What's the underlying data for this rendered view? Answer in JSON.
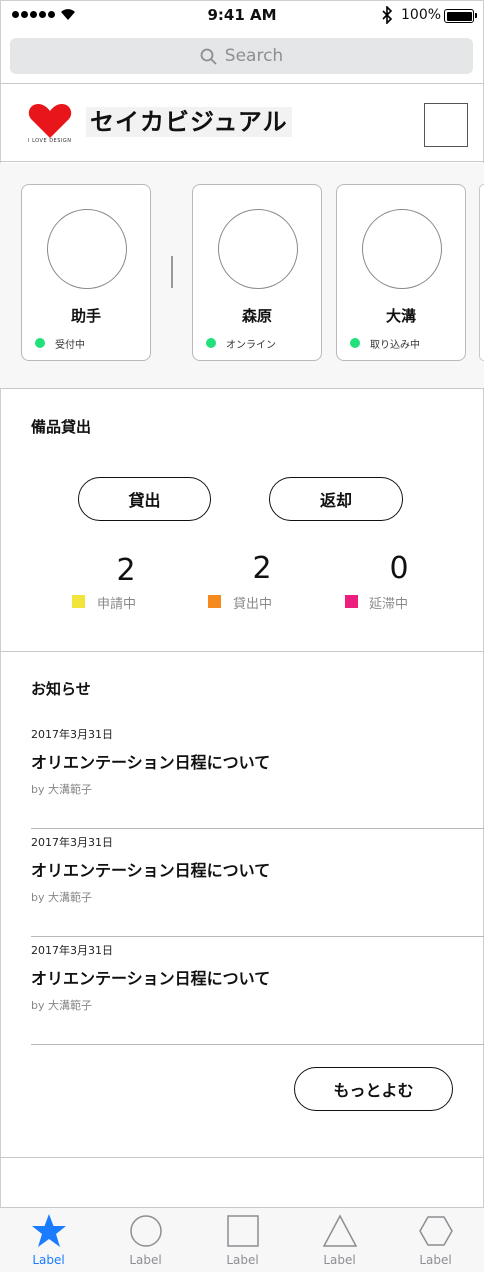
{
  "status_bar": {
    "time": "9:41 AM",
    "battery": "100%"
  },
  "search": {
    "placeholder": "Search"
  },
  "header": {
    "logo_text": "セイカビジュアル",
    "logo_tagline": "I LOVE DESIGN"
  },
  "staff": [
    {
      "name": "助手",
      "status": "受付中",
      "status_color": "#22e07a"
    },
    {
      "name": "森原",
      "status": "オンライン",
      "status_color": "#22e07a"
    },
    {
      "name": "大溝",
      "status": "取り込み中",
      "status_color": "#22e07a"
    }
  ],
  "equipment": {
    "title": "備品貸出",
    "lend_label": "貸出",
    "return_label": "返却",
    "stats": [
      {
        "count": "2",
        "label": "申請中",
        "color": "#f2e53a"
      },
      {
        "count": "2",
        "label": "貸出中",
        "color": "#f58a1f"
      },
      {
        "count": "0",
        "label": "延滞中",
        "color": "#ee1f7c"
      }
    ]
  },
  "news": {
    "title": "お知らせ",
    "items": [
      {
        "date": "2017年3月31日",
        "headline": "オリエンテーション日程について",
        "author": "by 大溝範子"
      },
      {
        "date": "2017年3月31日",
        "headline": "オリエンテーション日程について",
        "author": "by 大溝範子"
      },
      {
        "date": "2017年3月31日",
        "headline": "オリエンテーション日程について",
        "author": "by 大溝範子"
      }
    ],
    "more_label": "もっとよむ"
  },
  "tabbar": {
    "accent": "#1a7cff",
    "tabs": [
      {
        "label": "Label",
        "icon": "star-icon"
      },
      {
        "label": "Label",
        "icon": "circle-icon"
      },
      {
        "label": "Label",
        "icon": "square-icon"
      },
      {
        "label": "Label",
        "icon": "triangle-icon"
      },
      {
        "label": "Label",
        "icon": "hexagon-icon"
      }
    ]
  }
}
